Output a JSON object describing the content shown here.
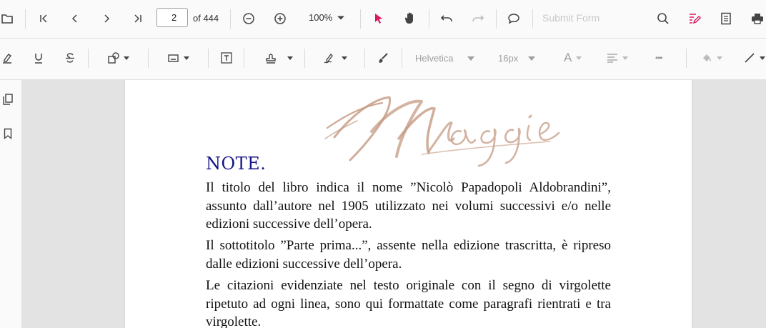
{
  "toolbar": {
    "current_page": "2",
    "page_count_label": "of 444",
    "zoom_label": "100%",
    "submit_form_label": "Submit Form"
  },
  "annotation_toolbar": {
    "font_family": "Helvetica",
    "font_size": "16px",
    "font_color_glyph": "A",
    "more_glyph": "•••"
  },
  "document": {
    "signature_text": "Maggie",
    "heading": "NOTE.",
    "paragraphs": [
      "Il titolo del libro indica il nome ”Nicolò Papadopoli Aldobrandini”, assunto dall’autore nel 1905 utilizzato nei volumi successivi e/o nelle edizioni successive dell’opera.",
      "Il sottotitolo ”Parte prima...”, assente nella edizione trascritta, è ripreso dalle edizioni successive dell’opera.",
      "Le citazioni evidenziate nel testo originale con il segno di virgolette ripetuto ad ogni linea, sono qui formattate come paragrafi rientrati e tra virgolette."
    ]
  },
  "colors": {
    "accent_pink": "#d81b60",
    "heading_blue": "#151586",
    "signature_brown": "#c49a82"
  },
  "icons": [
    "folder-icon",
    "first-page-icon",
    "previous-page-icon",
    "next-page-icon",
    "last-page-icon",
    "zoom-out-icon",
    "zoom-in-icon",
    "select-pointer-icon",
    "pan-hand-icon",
    "undo-icon",
    "redo-icon",
    "comment-icon",
    "search-icon",
    "edit-annotation-icon",
    "form-designer-icon",
    "print-icon",
    "highlight-icon",
    "underline-icon",
    "strikethrough-icon",
    "shape-icon",
    "calibrate-icon",
    "free-text-icon",
    "stamp-icon",
    "signature-icon",
    "ink-icon",
    "fill-color-icon",
    "line-icon",
    "thumbnails-icon",
    "bookmark-icon"
  ]
}
